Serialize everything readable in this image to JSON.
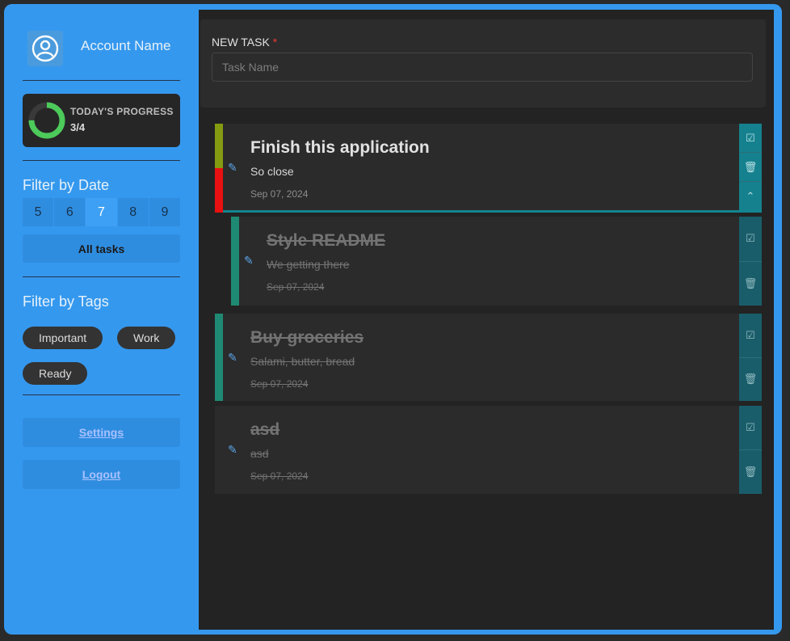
{
  "sidebar": {
    "account_name": "Account Name",
    "progress": {
      "title": "TODAY'S PROGRESS",
      "value": "3/4",
      "done": 3,
      "total": 4,
      "color": "#4cca5a"
    },
    "filter_date_title": "Filter by Date",
    "dates": [
      "5",
      "6",
      "7",
      "8",
      "9"
    ],
    "active_date": "7",
    "all_tasks_label": "All tasks",
    "filter_tags_title": "Filter by Tags",
    "tags": [
      "Important",
      "Work",
      "Ready"
    ],
    "settings_label": "Settings",
    "logout_label": "Logout"
  },
  "new_task": {
    "label": "NEW TASK",
    "required_mark": "*",
    "placeholder": "Task Name",
    "value": ""
  },
  "tasks": [
    {
      "title": "Finish this application",
      "description": "So close",
      "date": "Sep 07, 2024",
      "done": false,
      "stripe_colors": [
        "#849a10",
        "#e81010"
      ],
      "icons": [
        "check-square-icon",
        "trash-icon",
        "chevron-up-icon"
      ]
    },
    {
      "title": "Style README",
      "description": "We getting there",
      "date": "Sep 07, 2024",
      "done": true,
      "stripe_colors": [
        "#1f8a73"
      ],
      "icons": [
        "check-square-icon",
        "trash-icon"
      ]
    },
    {
      "title": "Buy groceries",
      "description": "Salami, butter, bread",
      "date": "Sep 07, 2024",
      "done": true,
      "stripe_colors": [
        "#1f8a73"
      ],
      "icons": [
        "check-square-icon",
        "trash-icon"
      ]
    },
    {
      "title": "asd",
      "description": "asd",
      "date": "Sep 07, 2024",
      "done": true,
      "stripe_colors": [],
      "icons": [
        "check-square-icon",
        "trash-icon"
      ]
    }
  ],
  "colors": {
    "accent": "#3598ef",
    "panel": "#232323",
    "card": "#2b2b2b",
    "action": "#15818e"
  }
}
